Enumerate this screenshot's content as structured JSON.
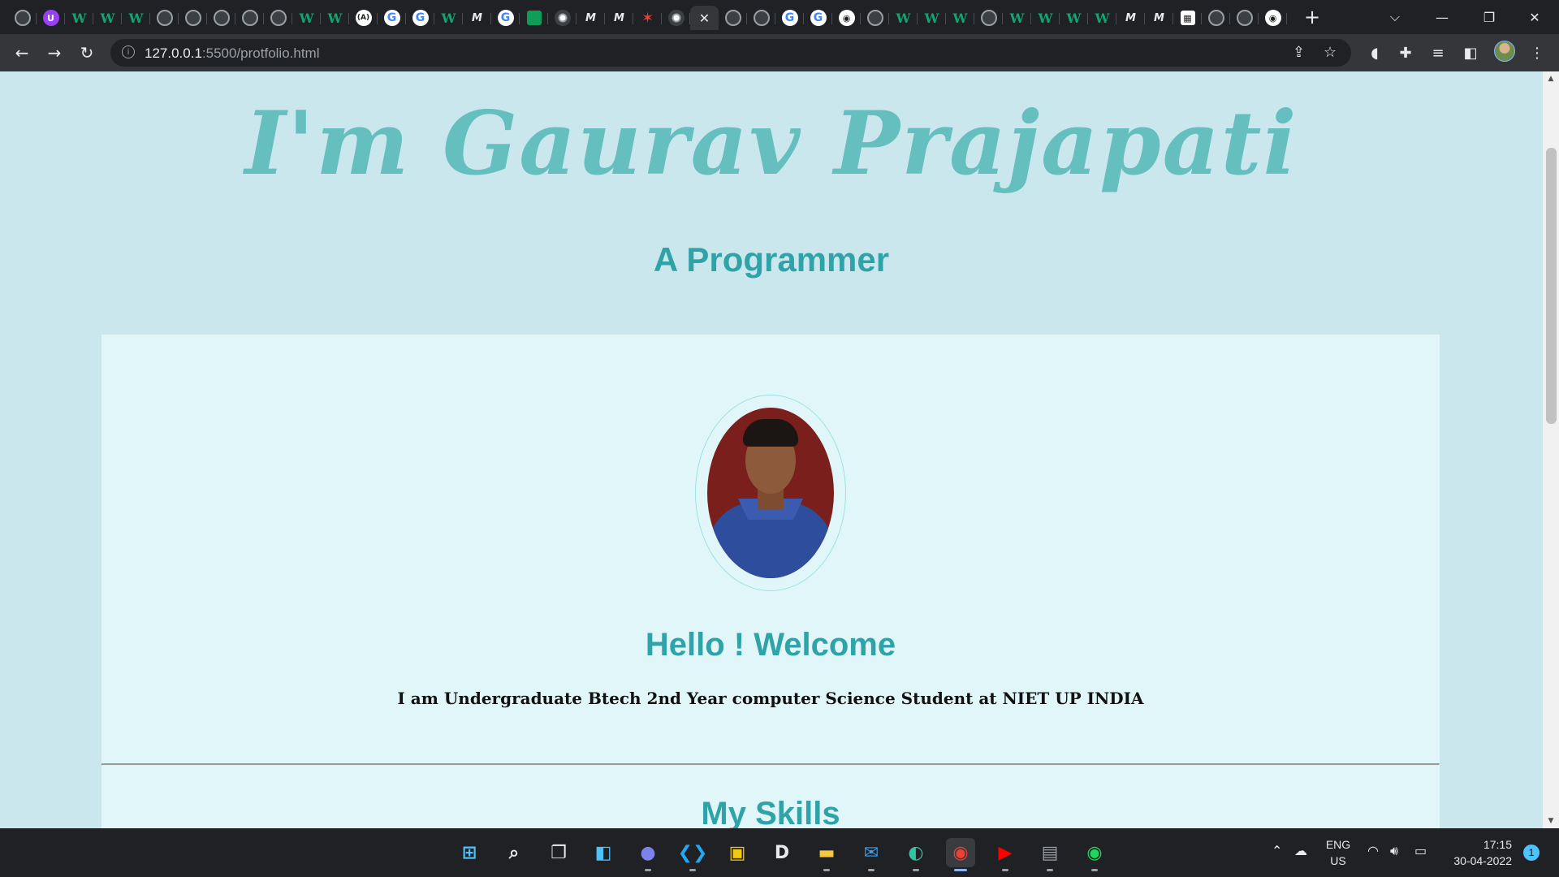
{
  "browser": {
    "tabs": [
      {
        "icon": "globe-icon",
        "glyph": ""
      },
      {
        "icon": "ublock-icon",
        "glyph": "U"
      },
      {
        "icon": "w-site-icon",
        "glyph": "W"
      },
      {
        "icon": "w-site-icon",
        "glyph": "W"
      },
      {
        "icon": "w-site-icon",
        "glyph": "W"
      },
      {
        "icon": "globe-icon",
        "glyph": ""
      },
      {
        "icon": "globe-icon",
        "glyph": ""
      },
      {
        "icon": "globe-icon",
        "glyph": ""
      },
      {
        "icon": "globe-icon",
        "glyph": ""
      },
      {
        "icon": "globe-icon",
        "glyph": ""
      },
      {
        "icon": "w-site-icon",
        "glyph": "W"
      },
      {
        "icon": "w-site-icon",
        "glyph": "W"
      },
      {
        "icon": "code-brace-icon",
        "glyph": "(A)"
      },
      {
        "icon": "google-icon",
        "glyph": "G"
      },
      {
        "icon": "google-icon",
        "glyph": "G"
      },
      {
        "icon": "w-site-icon",
        "glyph": "W"
      },
      {
        "icon": "m-site-icon",
        "glyph": "M"
      },
      {
        "icon": "google-icon",
        "glyph": "G"
      },
      {
        "icon": "sheets-icon",
        "glyph": ""
      },
      {
        "icon": "chrome-icon",
        "glyph": ""
      },
      {
        "icon": "m-site-icon",
        "glyph": "M"
      },
      {
        "icon": "m-site-icon",
        "glyph": "M"
      },
      {
        "icon": "star-icon",
        "glyph": "✶"
      },
      {
        "icon": "chrome-icon",
        "glyph": ""
      },
      {
        "icon": "close-icon",
        "glyph": "✕",
        "active": true
      },
      {
        "icon": "globe-icon",
        "glyph": ""
      },
      {
        "icon": "globe-icon",
        "glyph": ""
      },
      {
        "icon": "google-icon",
        "glyph": "G"
      },
      {
        "icon": "google-icon",
        "glyph": "G"
      },
      {
        "icon": "github-icon",
        "glyph": "◉"
      },
      {
        "icon": "globe-icon",
        "glyph": ""
      },
      {
        "icon": "w-site-icon",
        "glyph": "W"
      },
      {
        "icon": "w-site-icon",
        "glyph": "W"
      },
      {
        "icon": "w-site-icon",
        "glyph": "W"
      },
      {
        "icon": "globe-icon",
        "glyph": ""
      },
      {
        "icon": "w-site-icon",
        "glyph": "W"
      },
      {
        "icon": "w-site-icon",
        "glyph": "W"
      },
      {
        "icon": "w-site-icon",
        "glyph": "W"
      },
      {
        "icon": "w-site-icon",
        "glyph": "W"
      },
      {
        "icon": "m-site-icon",
        "glyph": "M"
      },
      {
        "icon": "m-site-icon",
        "glyph": "M"
      },
      {
        "icon": "grid-site-icon",
        "glyph": "▦"
      },
      {
        "icon": "globe-icon",
        "glyph": ""
      },
      {
        "icon": "globe-icon",
        "glyph": ""
      },
      {
        "icon": "github-icon",
        "glyph": "◉"
      }
    ],
    "url_host": "127.0.0.1",
    "url_rest": ":5500/protfolio.html"
  },
  "page": {
    "hero_title": "I'm Gaurav Prajapati",
    "hero_subtitle": "A Programmer",
    "welcome": "Hello ! Welcome",
    "intro": "I am Undergraduate Btech 2nd Year computer Science Student at NIET UP INDIA",
    "skills_heading": "My Skills"
  },
  "taskbar": {
    "apps": [
      {
        "icon": "windows-start-icon",
        "glyph": "⊞",
        "color": "#4cc2ff"
      },
      {
        "icon": "search-icon",
        "glyph": "⌕",
        "color": "#e8eaed"
      },
      {
        "icon": "task-view-icon",
        "glyph": "❐",
        "color": "#e8eaed"
      },
      {
        "icon": "widgets-icon",
        "glyph": "◧",
        "color": "#4cc2ff"
      },
      {
        "icon": "teams-chat-icon",
        "glyph": "●",
        "color": "#7b83eb"
      },
      {
        "icon": "vscode-icon",
        "glyph": "❮❯",
        "color": "#23a9f2"
      },
      {
        "icon": "store-icon",
        "glyph": "▣",
        "color": "#f2c811"
      },
      {
        "icon": "dell-icon",
        "glyph": "D",
        "color": "#e8eaed"
      },
      {
        "icon": "file-explorer-icon",
        "glyph": "▬",
        "color": "#f8c843"
      },
      {
        "icon": "mail-icon",
        "glyph": "✉",
        "color": "#3b9ff2"
      },
      {
        "icon": "edge-icon",
        "glyph": "◐",
        "color": "#35c1a3"
      },
      {
        "icon": "chrome-icon",
        "glyph": "◉",
        "color": "#ea4335",
        "active": true
      },
      {
        "icon": "youtube-icon",
        "glyph": "▶",
        "color": "#ff0000"
      },
      {
        "icon": "calculator-icon",
        "glyph": "▤",
        "color": "#9aa0a6"
      },
      {
        "icon": "spotify-icon",
        "glyph": "◉",
        "color": "#1ed760"
      }
    ],
    "lang_top": "ENG",
    "lang_bottom": "US",
    "time": "17:15",
    "date": "30-04-2022",
    "notifications": "1"
  }
}
